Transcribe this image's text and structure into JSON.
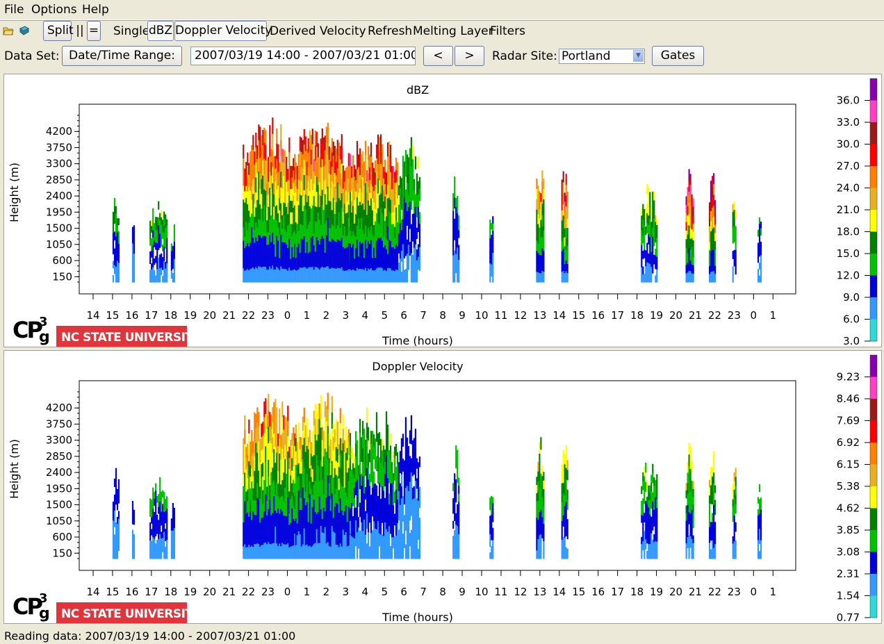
{
  "menubar": {
    "items": [
      "File",
      "Options",
      "Help"
    ]
  },
  "toolbar": {
    "open_icon": "folder-open-icon",
    "book_icon": "book-icon",
    "split_label": "Split",
    "vertical_label": "||",
    "horizontal_label": "=",
    "single_label": "Single",
    "dbz_label": "dBZ",
    "doppler_label": "Doppler Velocity",
    "derived_label": "Derived Velocity",
    "refresh_label": "Refresh",
    "melting_label": "Melting Layer",
    "filters_label": "Filters"
  },
  "dataset": {
    "label": "Data Set:",
    "range_button": "Date/Time Range:",
    "range_value": "2007/03/19 14:00 - 2007/03/21 01:00",
    "prev_button": "<",
    "next_button": ">",
    "site_label": "Radar Site:",
    "site_value": "Portland",
    "gates_button": "Gates"
  },
  "panels": [
    {
      "title": "dBZ",
      "ylabel": "Height (m)",
      "xlabel": "Time (hours)",
      "logo_text": "NC STATE UNIVERSITY",
      "logo_mark": "CP3g",
      "colorbar_labels": [
        "36.0",
        "33.0",
        "30.0",
        "27.0",
        "24.0",
        "21.0",
        "18.0",
        "15.0",
        "12.0",
        "9.0",
        "6.0",
        "3.0"
      ]
    },
    {
      "title": "Doppler Velocity",
      "ylabel": "Height (m)",
      "xlabel": "Time (hours)",
      "logo_text": "NC STATE UNIVERSITY",
      "logo_mark": "CP3g",
      "colorbar_labels": [
        "9.23",
        "8.46",
        "7.69",
        "6.92",
        "6.15",
        "5.38",
        "4.62",
        "3.85",
        "3.08",
        "2.31",
        "1.54",
        "0.77"
      ]
    }
  ],
  "chart_data": [
    {
      "type": "heatmap",
      "title": "dBZ",
      "xlabel": "Time (hours)",
      "ylabel": "Height (m)",
      "x_ticks": [
        "14",
        "15",
        "16",
        "17",
        "18",
        "19",
        "20",
        "21",
        "22",
        "23",
        "0",
        "1",
        "2",
        "3",
        "4",
        "5",
        "6",
        "7",
        "8",
        "9",
        "10",
        "11",
        "12",
        "13",
        "14",
        "15",
        "16",
        "17",
        "18",
        "19",
        "20",
        "21",
        "22",
        "23",
        "0",
        "1"
      ],
      "y_ticks": [
        4200,
        3750,
        3300,
        2850,
        2400,
        1950,
        1500,
        1050,
        600,
        150
      ],
      "ylim": [
        0,
        4650
      ],
      "colorscale": [
        "#30d8d8",
        "#3399ff",
        "#0000dd",
        "#00c000",
        "#008000",
        "#ffff00",
        "#e8b020",
        "#ff8000",
        "#ff0000",
        "#9b1b1b",
        "#ff40c0",
        "#8800aa"
      ],
      "colorbar_ticks": [
        36.0,
        33.0,
        30.0,
        27.0,
        24.0,
        21.0,
        18.0,
        15.0,
        12.0,
        9.0,
        6.0,
        3.0
      ],
      "echoes": [
        {
          "start_hour": 15.0,
          "end_hour": 15.3,
          "top_m": 2600,
          "peak": 4
        },
        {
          "start_hour": 16.0,
          "end_hour": 16.1,
          "top_m": 1900,
          "peak": 2
        },
        {
          "start_hour": 16.9,
          "end_hour": 17.8,
          "top_m": 2300,
          "peak": 4
        },
        {
          "start_hour": 18.0,
          "end_hour": 18.2,
          "top_m": 1700,
          "peak": 3
        },
        {
          "start_hour": 21.7,
          "end_hour": 24.4,
          "top_m": 4650,
          "peak": 8
        },
        {
          "start_hour": 24.4,
          "end_hour": 27.2,
          "top_m": 4650,
          "peak": 8
        },
        {
          "start_hour": 27.2,
          "end_hour": 29.7,
          "top_m": 4300,
          "peak": 8
        },
        {
          "start_hour": 29.7,
          "end_hour": 30.8,
          "top_m": 4100,
          "peak": 4
        },
        {
          "start_hour": 32.5,
          "end_hour": 32.8,
          "top_m": 3200,
          "peak": 3
        },
        {
          "start_hour": 34.4,
          "end_hour": 34.6,
          "top_m": 2200,
          "peak": 3
        },
        {
          "start_hour": 36.8,
          "end_hour": 37.2,
          "top_m": 3400,
          "peak": 7
        },
        {
          "start_hour": 38.1,
          "end_hour": 38.4,
          "top_m": 3400,
          "peak": 9
        },
        {
          "start_hour": 42.2,
          "end_hour": 43.0,
          "top_m": 2800,
          "peak": 5
        },
        {
          "start_hour": 44.5,
          "end_hour": 44.9,
          "top_m": 3300,
          "peak": 10
        },
        {
          "start_hour": 45.7,
          "end_hour": 46.0,
          "top_m": 3200,
          "peak": 10
        },
        {
          "start_hour": 46.9,
          "end_hour": 47.1,
          "top_m": 2700,
          "peak": 5
        },
        {
          "start_hour": 48.2,
          "end_hour": 48.4,
          "top_m": 2300,
          "peak": 3
        }
      ]
    },
    {
      "type": "heatmap",
      "title": "Doppler Velocity",
      "xlabel": "Time (hours)",
      "ylabel": "Height (m)",
      "x_ticks": [
        "14",
        "15",
        "16",
        "17",
        "18",
        "19",
        "20",
        "21",
        "22",
        "23",
        "0",
        "1",
        "2",
        "3",
        "4",
        "5",
        "6",
        "7",
        "8",
        "9",
        "10",
        "11",
        "12",
        "13",
        "14",
        "15",
        "16",
        "17",
        "18",
        "19",
        "20",
        "21",
        "22",
        "23",
        "0",
        "1"
      ],
      "y_ticks": [
        4200,
        3750,
        3300,
        2850,
        2400,
        1950,
        1500,
        1050,
        600,
        150
      ],
      "ylim": [
        0,
        4650
      ],
      "colorscale": [
        "#30d8d8",
        "#3399ff",
        "#0000dd",
        "#00c000",
        "#008000",
        "#ffff00",
        "#e8b020",
        "#ff8000",
        "#ff0000",
        "#9b1b1b",
        "#ff40c0",
        "#8800aa"
      ],
      "colorbar_ticks": [
        9.23,
        8.46,
        7.69,
        6.92,
        6.15,
        5.38,
        4.62,
        3.85,
        3.08,
        2.31,
        1.54,
        0.77
      ],
      "echoes": [
        {
          "start_hour": 15.0,
          "end_hour": 15.3,
          "top_m": 2600,
          "peak": 2
        },
        {
          "start_hour": 16.0,
          "end_hour": 16.1,
          "top_m": 1900,
          "peak": 2
        },
        {
          "start_hour": 16.9,
          "end_hour": 17.8,
          "top_m": 2300,
          "peak": 3
        },
        {
          "start_hour": 18.0,
          "end_hour": 18.2,
          "top_m": 1700,
          "peak": 2
        },
        {
          "start_hour": 21.7,
          "end_hour": 24.4,
          "top_m": 4650,
          "peak": 7
        },
        {
          "start_hour": 24.4,
          "end_hour": 27.2,
          "top_m": 4650,
          "peak": 6
        },
        {
          "start_hour": 27.2,
          "end_hour": 29.7,
          "top_m": 4300,
          "peak": 4
        },
        {
          "start_hour": 29.7,
          "end_hour": 30.8,
          "top_m": 4100,
          "peak": 2
        },
        {
          "start_hour": 32.5,
          "end_hour": 32.8,
          "top_m": 3200,
          "peak": 3
        },
        {
          "start_hour": 34.4,
          "end_hour": 34.6,
          "top_m": 2200,
          "peak": 3
        },
        {
          "start_hour": 36.8,
          "end_hour": 37.2,
          "top_m": 3400,
          "peak": 5
        },
        {
          "start_hour": 38.1,
          "end_hour": 38.4,
          "top_m": 3400,
          "peak": 5
        },
        {
          "start_hour": 42.2,
          "end_hour": 43.0,
          "top_m": 2800,
          "peak": 4
        },
        {
          "start_hour": 44.5,
          "end_hour": 44.9,
          "top_m": 3300,
          "peak": 5
        },
        {
          "start_hour": 45.7,
          "end_hour": 46.0,
          "top_m": 3200,
          "peak": 5
        },
        {
          "start_hour": 46.9,
          "end_hour": 47.1,
          "top_m": 2700,
          "peak": 5
        },
        {
          "start_hour": 48.2,
          "end_hour": 48.4,
          "top_m": 2300,
          "peak": 3
        }
      ]
    }
  ],
  "status": {
    "text": "Reading data: 2007/03/19 14:00 - 2007/03/21 01:00"
  }
}
